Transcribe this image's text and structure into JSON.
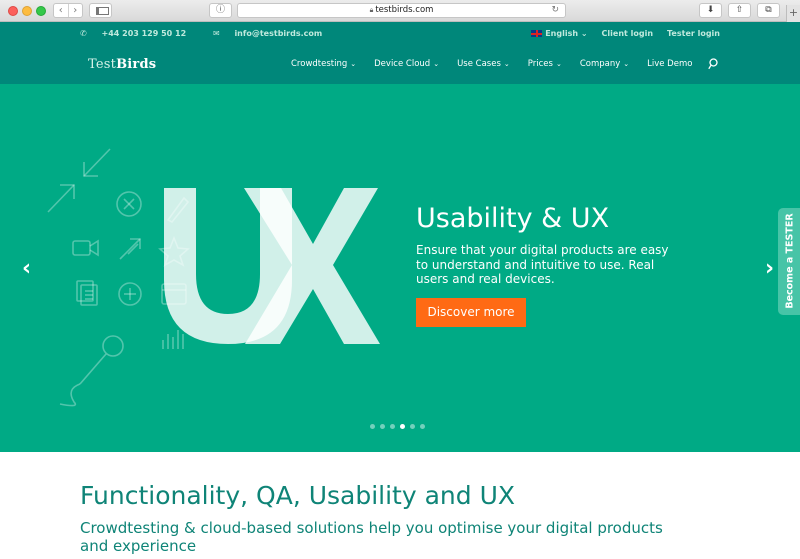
{
  "browser": {
    "url": "testbirds.com",
    "nav_back": "‹",
    "nav_forward": "›",
    "privacy_icon": "i-circle-icon",
    "reload_icon": "reload-icon",
    "new_tab": "+"
  },
  "topbar": {
    "phone": "+44 203 129 50 12",
    "email": "info@testbirds.com",
    "language": "English",
    "client_login": "Client login",
    "tester_login": "Tester login"
  },
  "nav": {
    "logo_pre": "Test",
    "logo_bold": "Birds",
    "items": [
      "Crowdtesting",
      "Device Cloud",
      "Use Cases",
      "Prices",
      "Company",
      "Live Demo"
    ]
  },
  "hero": {
    "title": "Usability & UX",
    "text": "Ensure that your digital products are easy to understand and intuitive to use. Real users and real devices.",
    "cta": "Discover more",
    "prev": "‹",
    "next": "›",
    "slide_count": 6,
    "active_slide": 4
  },
  "side_tab": "Become a TESTER",
  "section": {
    "title": "Functionality, QA, Usability and UX",
    "subtitle": "Crowdtesting & cloud-based solutions help you optimise your digital products and experience"
  },
  "colors": {
    "brand_dark": "#00877a",
    "hero_bg": "#00aa85",
    "cta": "#ff6a14",
    "heading": "#0f8477"
  }
}
